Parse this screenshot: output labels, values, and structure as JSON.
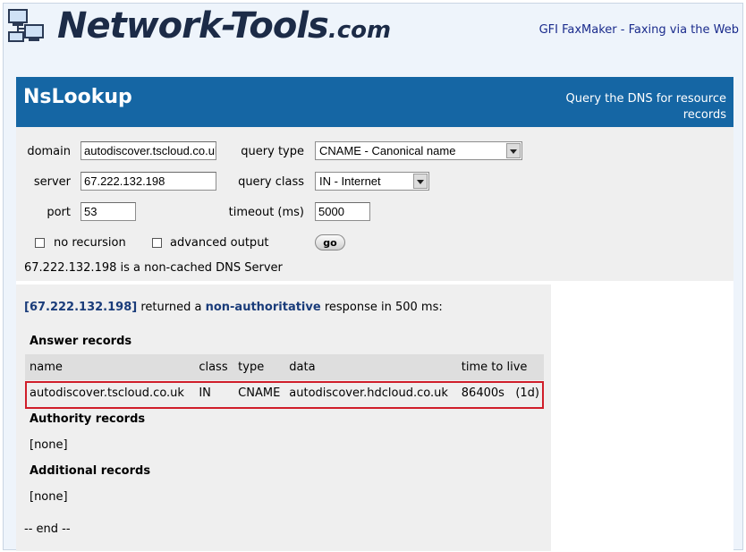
{
  "header": {
    "logo_main": "Network-Tools",
    "logo_domain": ".com",
    "ad_link": "GFI FaxMaker - Faxing via the Web"
  },
  "tool": {
    "title": "NsLookup",
    "subtitle": "Query the DNS for resource records"
  },
  "form": {
    "domain_label": "domain",
    "domain_value": "autodiscover.tscloud.co.uk",
    "query_type_label": "query type",
    "query_type_value": "CNAME - Canonical name",
    "server_label": "server",
    "server_value": "67.222.132.198",
    "query_class_label": "query class",
    "query_class_value": "IN - Internet",
    "port_label": "port",
    "port_value": "53",
    "timeout_label": "timeout (ms)",
    "timeout_value": "5000",
    "no_recursion_label": "no recursion",
    "advanced_output_label": "advanced output",
    "go_label": "go",
    "server_note": "67.222.132.198 is a non-cached DNS Server"
  },
  "results": {
    "ip": "[67.222.132.198]",
    "returned": "returned a",
    "authority": "non-authoritative",
    "response": "response in 500 ms:",
    "answer_heading": "Answer records",
    "columns": [
      "name",
      "class",
      "type",
      "data",
      "time to live"
    ],
    "answer": {
      "name": "autodiscover.tscloud.co.uk",
      "class": "IN",
      "type": "CNAME",
      "data": "autodiscover.hdcloud.co.uk",
      "ttl": "86400s",
      "ttl_human": "(1d)"
    },
    "authority_heading": "Authority records",
    "authority_value": "[none]",
    "additional_heading": "Additional records",
    "additional_value": "[none]",
    "end": "-- end --"
  },
  "colors": {
    "titlebar": "#1566a4",
    "highlight": "#d01e2a",
    "link": "#1a2b8c"
  }
}
